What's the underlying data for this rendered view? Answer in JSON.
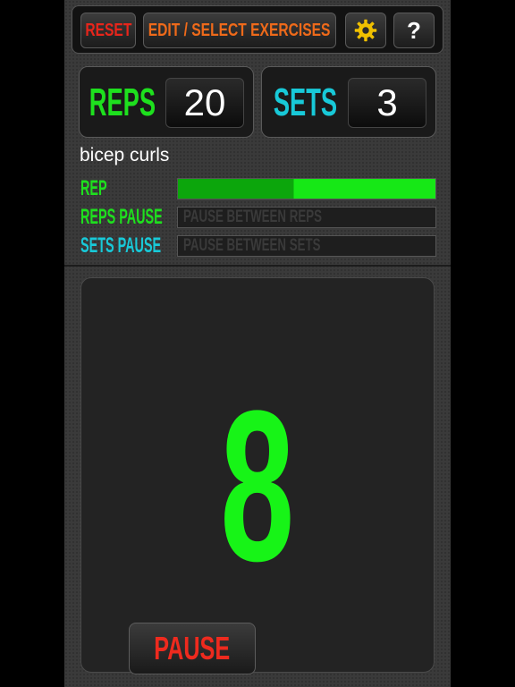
{
  "toolbar": {
    "reset_label": "RESET",
    "edit_label": "EDIT / SELECT EXERCISES",
    "settings_icon": "gear-icon",
    "help_label": "?"
  },
  "counters": {
    "reps_label": "REPS",
    "reps_value": "20",
    "sets_label": "SETS",
    "sets_value": "3"
  },
  "exercise": {
    "name": "bicep curls"
  },
  "progress": {
    "rep": {
      "label": "REP",
      "fraction": 1.0,
      "text": ""
    },
    "reps_pause": {
      "label": "REPS PAUSE",
      "fraction": 0,
      "text": "PAUSE BETWEEN REPS"
    },
    "sets_pause": {
      "label": "SETS PAUSE",
      "fraction": 0,
      "text": "PAUSE BETWEEN SETS"
    }
  },
  "main": {
    "current_count": "8",
    "pause_label": "PAUSE"
  },
  "colors": {
    "green": "#1ee01e",
    "cyan": "#18c9d8",
    "red": "#e8251b",
    "orange": "#ef6a1a",
    "gold": "#f0c000"
  }
}
